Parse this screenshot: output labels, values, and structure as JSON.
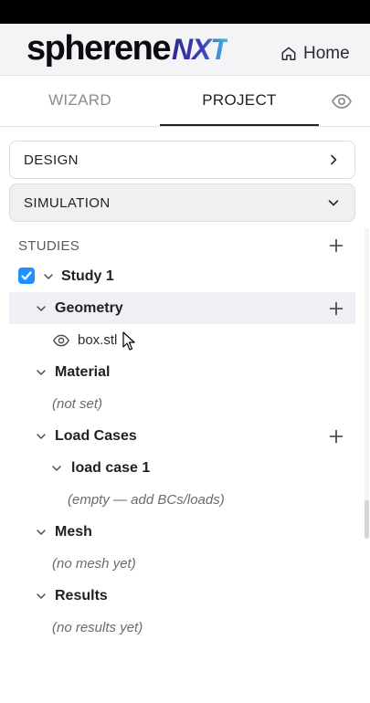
{
  "brand": {
    "logo_main": "spherene",
    "logo_suffix": "NXT"
  },
  "header": {
    "home_label": "Home"
  },
  "tabs": {
    "wizard": "WIZARD",
    "project": "PROJECT"
  },
  "panels": {
    "design": "DESIGN",
    "simulation": "SIMULATION"
  },
  "studies": {
    "label": "STUDIES",
    "study": {
      "name": "Study 1",
      "checked": true
    },
    "geometry": {
      "label": "Geometry",
      "file": "box.stl"
    },
    "material": {
      "label": "Material",
      "value": "(not set)"
    },
    "load_cases": {
      "label": "Load Cases",
      "case_name": "load case 1",
      "case_value": "(empty — add BCs/loads)"
    },
    "mesh": {
      "label": "Mesh",
      "value": "(no mesh yet)"
    },
    "results": {
      "label": "Results",
      "value": "(no results yet)"
    }
  },
  "colors": {
    "checkbox": "#1e90ff",
    "highlight_row": "#efeff5",
    "sim_panel_bg": "#f1f0ee"
  }
}
